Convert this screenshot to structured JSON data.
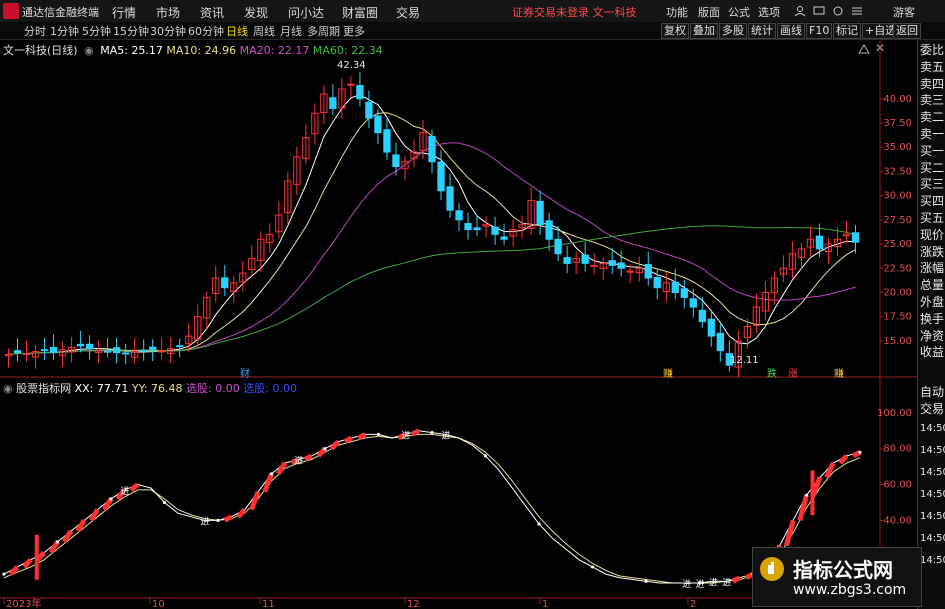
{
  "app": {
    "brand": "通达信金融终端"
  },
  "menu": {
    "items": [
      "行情",
      "市场",
      "资讯",
      "发现",
      "问小达",
      "财富圈",
      "交易"
    ]
  },
  "login_warning": "证券交易未登录  文一科技",
  "menu_right": [
    "功能",
    "版面",
    "公式",
    "选项"
  ],
  "guest_label": "游客",
  "periods": [
    "分时",
    "1分钟",
    "5分钟",
    "15分钟",
    "30分钟",
    "60分钟",
    "日线",
    "周线",
    "月线",
    "多周期",
    "更多"
  ],
  "active_period": "日线",
  "toolbar_right": [
    "复权",
    "叠加",
    "多股",
    "统计",
    "画线",
    "F10",
    "标记",
    "+自选",
    "返回"
  ],
  "main_legend": {
    "title": "文一科技(日线)",
    "ma5": "MA5: 25.17",
    "ma10": "MA10: 24.96",
    "ma20": "MA20: 22.17",
    "ma60": "MA60: 22.34"
  },
  "ind_legend": {
    "name": "股票指标网",
    "xx": "XX: 77.71",
    "yy": "YY: 76.48",
    "xuangu": "选股: 0.00",
    "xuandian": "选股: 0.00"
  },
  "side_panel": [
    "委比",
    "卖五",
    "卖四",
    "卖三",
    "卖二",
    "卖一",
    "买一",
    "买二",
    "买三",
    "买四",
    "买五",
    "现价",
    "涨跌",
    "涨幅",
    "总量",
    "外盘",
    "换手",
    "净资",
    "收益"
  ],
  "side_panel_lower": [
    "自动",
    "交易"
  ],
  "side_times": [
    "14:50",
    "14:50",
    "14:50",
    "14:50",
    "14:50",
    "14:50",
    "14:50"
  ],
  "annotations": {
    "high": "42.34",
    "low": "12.11"
  },
  "event_tags": [
    {
      "label": "财",
      "color": "#3aa0ff"
    },
    {
      "label": "赚",
      "color": "#ffcc33"
    },
    {
      "label": "跌",
      "color": "#44dd44"
    },
    {
      "label": "涨",
      "color": "#ff4444"
    },
    {
      "label": "赚",
      "color": "#ffcc33"
    }
  ],
  "signal_label": "进",
  "signal_label_alt": "进",
  "colors": {
    "up": "#ff3030",
    "down": "#2ad0ff",
    "ma5": "#ffffff",
    "ma10": "#e8e08a",
    "ma20": "#c040c0",
    "ma60": "#3fa83f",
    "axis": "#9a1e1e"
  },
  "watermark": {
    "title": "指标公式网",
    "url": "www.zbgs3.com"
  },
  "chart_data": [
    {
      "type": "line",
      "title": "文一科技(日线)",
      "y_ticks": [
        "40.00",
        "37.50",
        "35.00",
        "32.50",
        "30.00",
        "27.50",
        "25.00",
        "22.50",
        "20.00",
        "17.50",
        "15.00"
      ],
      "x_ticks": [
        "2023年",
        "10",
        "11",
        "12",
        "1",
        "2"
      ],
      "ylim": [
        12,
        44
      ],
      "close": [
        13.6,
        13.8,
        13.7,
        13.9,
        14.0,
        13.8,
        14.1,
        14.3,
        14.5,
        14.2,
        14.0,
        13.9,
        13.8,
        13.7,
        13.9,
        14.0,
        14.1,
        14.0,
        14.2,
        14.5,
        15.5,
        17.5,
        19.5,
        21.5,
        20.5,
        21.0,
        22.0,
        23.5,
        25.5,
        26.0,
        28.0,
        31.5,
        34.0,
        36.0,
        38.5,
        40.5,
        39.0,
        41.0,
        41.5,
        40.0,
        38.0,
        36.5,
        34.5,
        33.0,
        33.5,
        34.5,
        36.5,
        33.5,
        30.5,
        28.5,
        27.5,
        26.5,
        26.5,
        27.0,
        26.0,
        25.5,
        26.5,
        27.0,
        29.5,
        27.0,
        25.5,
        24.0,
        23.0,
        23.5,
        23.0,
        22.8,
        23.0,
        22.8,
        22.5,
        22.2,
        22.5,
        21.5,
        20.5,
        21.0,
        20.0,
        19.5,
        18.5,
        17.0,
        15.5,
        14.0,
        12.5,
        15.0,
        16.5,
        18.5,
        20.0,
        21.5,
        22.5,
        24.0,
        24.5,
        25.5,
        24.5,
        25.0,
        25.5,
        26.0,
        25.2
      ],
      "series": [
        {
          "name": "MA5"
        },
        {
          "name": "MA10"
        },
        {
          "name": "MA20"
        },
        {
          "name": "MA60"
        }
      ]
    },
    {
      "type": "line",
      "title": "股票指标网",
      "y_ticks": [
        "100.00",
        "80.00",
        "60.00",
        "40.00",
        "20.00"
      ],
      "ylim": [
        0,
        110
      ],
      "xx": [
        10,
        14,
        18,
        22,
        28,
        34,
        40,
        46,
        52,
        57,
        60,
        58,
        50,
        44,
        42,
        40,
        40,
        42,
        46,
        56,
        66,
        72,
        74,
        76,
        80,
        84,
        86,
        88,
        88,
        86,
        88,
        90,
        89,
        88,
        86,
        82,
        76,
        68,
        58,
        48,
        38,
        30,
        24,
        18,
        14,
        10,
        8,
        7,
        6,
        5,
        5,
        5,
        5,
        6,
        6,
        8,
        10,
        16,
        26,
        40,
        54,
        64,
        72,
        76,
        78
      ],
      "yy": [
        8,
        11,
        14,
        18,
        24,
        30,
        36,
        42,
        48,
        53,
        57,
        57,
        52,
        46,
        43,
        41,
        40,
        41,
        44,
        52,
        62,
        69,
        72,
        74,
        78,
        82,
        84,
        86,
        87,
        86,
        87,
        88,
        88,
        87,
        86,
        83,
        78,
        71,
        62,
        52,
        42,
        34,
        27,
        21,
        16,
        12,
        9,
        8,
        7,
        6,
        5,
        5,
        5,
        5,
        6,
        7,
        9,
        13,
        21,
        33,
        47,
        58,
        67,
        72,
        75
      ],
      "series": [
        {
          "name": "XX"
        },
        {
          "name": "YY"
        }
      ]
    }
  ]
}
